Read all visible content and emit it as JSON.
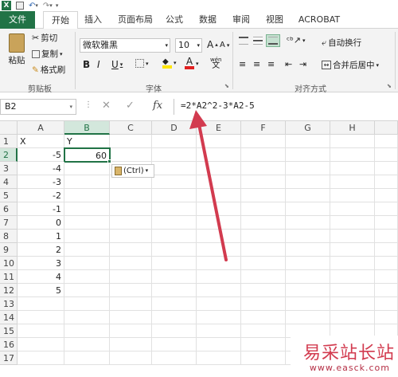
{
  "qat": {
    "redo": "↷",
    "undo": "↶"
  },
  "tabs": [
    "文件",
    "开始",
    "插入",
    "页面布局",
    "公式",
    "数据",
    "审阅",
    "视图",
    "ACROBAT"
  ],
  "ribbon": {
    "paste": "粘贴",
    "cut": "剪切",
    "copy": "复制",
    "format_painter": "格式刷",
    "clipboard_label": "剪贴板",
    "font_name": "微软雅黑",
    "font_size": "10",
    "bold": "B",
    "italic": "I",
    "underline": "U",
    "font_label": "字体",
    "wrap_text": "自动换行",
    "merge_center": "合并后居中",
    "align_label": "对齐方式",
    "grow_font": "A",
    "shrink_font": "A",
    "font_color": "A",
    "wen": "wén"
  },
  "formula_bar": {
    "name_box": "B2",
    "cancel": "✕",
    "enter": "✓",
    "fx": "fx",
    "formula": "=2*A2^2-3*A2-5"
  },
  "columns": [
    "A",
    "B",
    "C",
    "D",
    "E",
    "F",
    "G",
    "H"
  ],
  "rows": [
    "1",
    "2",
    "3",
    "4",
    "5",
    "6",
    "7",
    "8",
    "9",
    "10",
    "11",
    "12",
    "13",
    "14",
    "15",
    "16",
    "17"
  ],
  "cells": {
    "A1": "X",
    "B1": "Y",
    "A2": "-5",
    "B2": "60",
    "A3": "-4",
    "A4": "-3",
    "A5": "-2",
    "A6": "-1",
    "A7": "0",
    "A8": "1",
    "A9": "2",
    "A10": "3",
    "A11": "4",
    "A12": "5"
  },
  "paste_options": "(Ctrl)",
  "watermark": {
    "title": "易采站长站",
    "url": "www.easck.com"
  },
  "colors": {
    "accent": "#217346",
    "arrow": "#d23b4f"
  }
}
